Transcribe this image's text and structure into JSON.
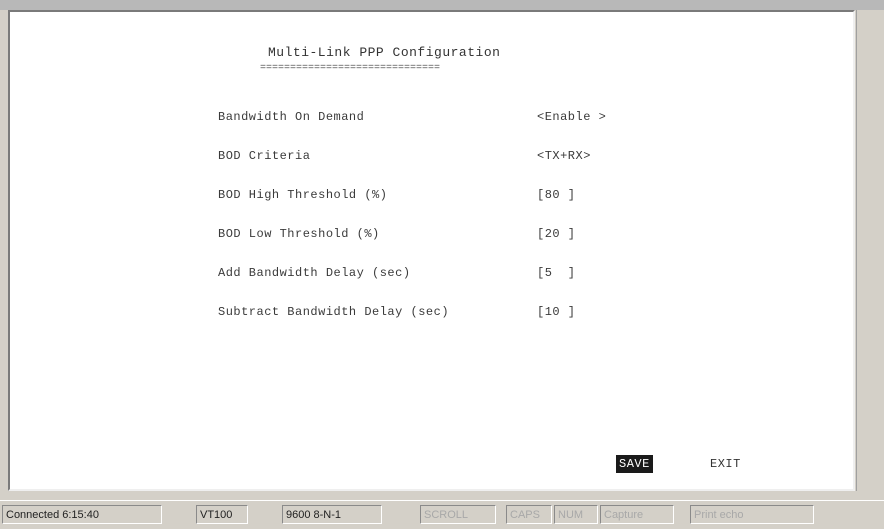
{
  "terminal": {
    "title": "Multi-Link PPP Configuration",
    "title_underline": "==============================",
    "rows": [
      {
        "label": "Bandwidth On Demand",
        "value": "<Enable >"
      },
      {
        "label": "BOD Criteria",
        "value": "<TX+RX>"
      },
      {
        "label": "BOD High Threshold (%)",
        "value": "[80 ]"
      },
      {
        "label": "BOD Low Threshold (%)",
        "value": "[20 ]"
      },
      {
        "label": "Add Bandwidth Delay (sec)",
        "value": "[5  ]"
      },
      {
        "label": "Subtract Bandwidth Delay (sec)",
        "value": "[10 ]"
      }
    ],
    "save_label": "SAVE",
    "exit_label": "EXIT"
  },
  "statusbar": {
    "connected": "Connected 6:15:40",
    "emulation": "VT100",
    "port_settings": "9600 8-N-1",
    "scroll": "SCROLL",
    "caps": "CAPS",
    "num": "NUM",
    "capture": "Capture",
    "print_echo": "Print echo"
  }
}
